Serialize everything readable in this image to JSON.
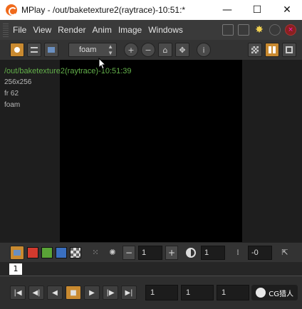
{
  "window": {
    "title": "MPlay - /out/baketexture2(raytrace)-10:51:*",
    "minimize": "—",
    "maximize": "☐",
    "close": "✕"
  },
  "menu": {
    "items": [
      "File",
      "View",
      "Render",
      "Anim",
      "Image",
      "Windows"
    ]
  },
  "toolbar": {
    "channel_value": "foam",
    "info_glyph": "i"
  },
  "viewport": {
    "image_label": "/out/baketexture2(raytrace)-10:51:39",
    "resolution": "256x256",
    "frame_label": "fr 62",
    "plane": "foam"
  },
  "controls": {
    "minus": "−",
    "plus": "+",
    "exposure_value": "1",
    "gamma_value": "1",
    "offset_value": "-0"
  },
  "timeline": {
    "current_frame": "1"
  },
  "playback": {
    "field1": "1",
    "field2": "1",
    "field3": "1"
  },
  "watermark": {
    "text": "CG猎人"
  },
  "colors": {
    "accent_orange": "#c98a30",
    "overlay_green": "#63b04a",
    "red_swatch": "#d23a2e",
    "green_swatch": "#5aa437",
    "blue_swatch": "#3a6fc0"
  }
}
